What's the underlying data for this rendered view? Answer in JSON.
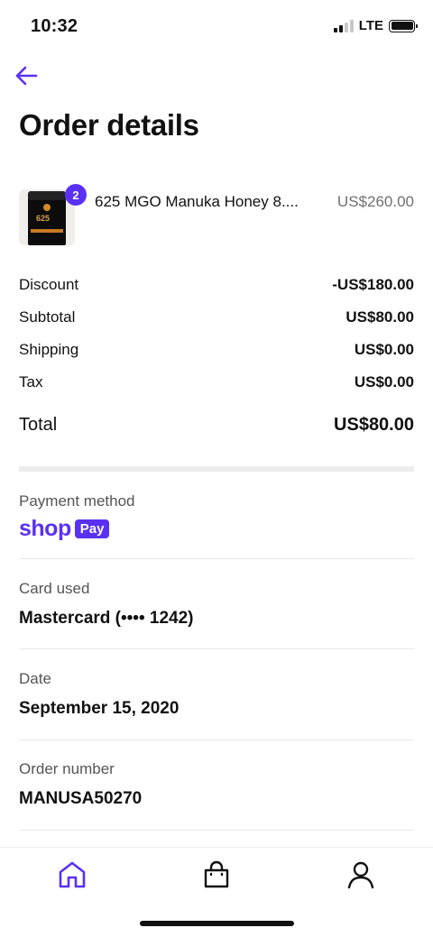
{
  "status_bar": {
    "time": "10:32",
    "network": "LTE"
  },
  "header": {
    "back_icon": "arrow-left-icon",
    "title": "Order details"
  },
  "item": {
    "quantity": "2",
    "name": "625 MGO Manuka Honey 8....",
    "price": "US$260.00",
    "thumb_text": "625"
  },
  "summary": {
    "discount_label": "Discount",
    "discount_value": "-US$180.00",
    "subtotal_label": "Subtotal",
    "subtotal_value": "US$80.00",
    "shipping_label": "Shipping",
    "shipping_value": "US$0.00",
    "tax_label": "Tax",
    "tax_value": "US$0.00",
    "total_label": "Total",
    "total_value": "US$80.00"
  },
  "payment": {
    "label": "Payment method",
    "brand_word": "shop",
    "brand_pill": "Pay"
  },
  "card": {
    "label": "Card used",
    "value": "Mastercard (•••• 1242)"
  },
  "date": {
    "label": "Date",
    "value": "September 15, 2020"
  },
  "order": {
    "label": "Order number",
    "value": "MANUSA50270"
  },
  "tab_bar": {
    "items": [
      "home-icon",
      "shopping-bag-icon",
      "user-icon"
    ]
  },
  "colors": {
    "accent": "#5a31f4",
    "text": "#111111",
    "muted": "#707070"
  }
}
